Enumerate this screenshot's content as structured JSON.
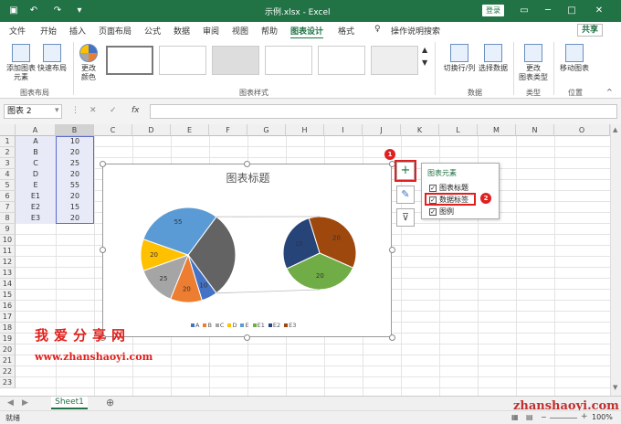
{
  "window": {
    "title": "示例.xlsx  -  Excel",
    "login": "登录"
  },
  "tabs": [
    "文件",
    "开始",
    "插入",
    "页面布局",
    "公式",
    "数据",
    "审阅",
    "视图",
    "帮助",
    "图表设计",
    "格式"
  ],
  "active_tab": "图表设计",
  "tell_me": "操作说明搜索",
  "share": "共享",
  "ribbon": {
    "add_element": "添加图表\n元素",
    "quick_layout": "快速布局",
    "change_color": "更改\n颜色",
    "group_layout": "图表布局",
    "group_style": "图表样式",
    "switch_rowcol": "切换行/列",
    "select_data": "选择数据",
    "group_data": "数据",
    "change_type": "更改\n图表类型",
    "group_type": "类型",
    "move_chart": "移动图表",
    "group_location": "位置"
  },
  "formula_bar": {
    "name_box": "图表 2",
    "fx": "fx"
  },
  "columns": [
    "A",
    "B",
    "C",
    "D",
    "E",
    "F",
    "G",
    "H",
    "I",
    "J",
    "K",
    "L",
    "M",
    "N",
    "O"
  ],
  "rows": [
    "1",
    "2",
    "3",
    "4",
    "5",
    "6",
    "7",
    "8",
    "9",
    "10",
    "11",
    "12",
    "13",
    "14",
    "15",
    "16",
    "17",
    "18",
    "19",
    "20",
    "21",
    "22",
    "23"
  ],
  "cells": [
    {
      "a": "A",
      "b": "10"
    },
    {
      "a": "B",
      "b": "20"
    },
    {
      "a": "C",
      "b": "25"
    },
    {
      "a": "D",
      "b": "20"
    },
    {
      "a": "E",
      "b": "55"
    },
    {
      "a": "E1",
      "b": "20"
    },
    {
      "a": "E2",
      "b": "15"
    },
    {
      "a": "E3",
      "b": "20"
    }
  ],
  "chart": {
    "title": "图表标题",
    "legend": [
      "A",
      "B",
      "C",
      "D",
      "E",
      "E1",
      "E2",
      "E3"
    ],
    "colors": [
      "#4472c4",
      "#ed7d31",
      "#a5a5a5",
      "#ffc000",
      "#5b9bd5",
      "#70ad47",
      "#264478",
      "#9e480e"
    ]
  },
  "chart_data": {
    "type": "pie",
    "title": "图表标题",
    "categories": [
      "A",
      "B",
      "C",
      "D",
      "E",
      "E1",
      "E2",
      "E3"
    ],
    "values": [
      10,
      20,
      25,
      20,
      55,
      20,
      15,
      20
    ],
    "labels_primary": [
      {
        "label": "55"
      },
      {
        "label": "20"
      },
      {
        "label": "25"
      },
      {
        "label": "20"
      },
      {
        "label": "10"
      }
    ],
    "labels_secondary": [
      {
        "label": "20"
      },
      {
        "label": "15"
      },
      {
        "label": "20"
      }
    ]
  },
  "flyout": {
    "title": "图表元素",
    "items": [
      {
        "label": "图表标题",
        "checked": true
      },
      {
        "label": "数据标签",
        "checked": true
      },
      {
        "label": "图例",
        "checked": true
      }
    ]
  },
  "badges": {
    "one": "1",
    "two": "2"
  },
  "watermark": {
    "cn": "我爱分享网",
    "url": "www.zhanshaoyi.com",
    "url2": "zhanshaoyi.com"
  },
  "sheet": {
    "name": "Sheet1"
  },
  "status": {
    "mode": "就绪",
    "zoom": "100%"
  }
}
